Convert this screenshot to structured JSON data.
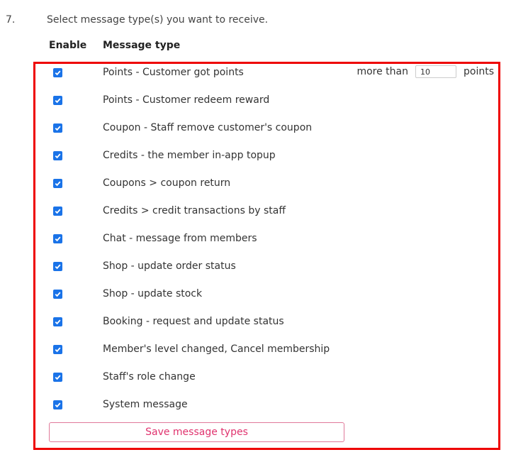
{
  "step": {
    "number": "7.",
    "instruction": "Select message type(s) you want to receive."
  },
  "table": {
    "header_enable": "Enable",
    "header_type": "Message type"
  },
  "message_types": [
    {
      "label": "Points - Customer got points",
      "enabled": true
    },
    {
      "label": "Points - Customer redeem reward",
      "enabled": true
    },
    {
      "label": "Coupon - Staff remove customer's coupon",
      "enabled": true
    },
    {
      "label": "Credits - the member in-app topup",
      "enabled": true
    },
    {
      "label": "Coupons > coupon return",
      "enabled": true
    },
    {
      "label": "Credits > credit transactions by staff",
      "enabled": true
    },
    {
      "label": "Chat - message from members",
      "enabled": true
    },
    {
      "label": "Shop - update order status",
      "enabled": true
    },
    {
      "label": "Shop - update stock",
      "enabled": true
    },
    {
      "label": "Booking - request and update status",
      "enabled": true
    },
    {
      "label": "Member's level changed, Cancel membership",
      "enabled": true
    },
    {
      "label": "Staff's role change",
      "enabled": true
    },
    {
      "label": "System message",
      "enabled": true
    }
  ],
  "points_threshold": {
    "prefix": "more than",
    "value": "10",
    "suffix": "points"
  },
  "save_button_label": "Save message types",
  "colors": {
    "highlight_border": "#ee0000",
    "checkbox": "#1a73e8",
    "button_text": "#e0336e",
    "button_border": "#e07a9a"
  },
  "icons": {
    "checkbox": "checkmark-icon"
  }
}
